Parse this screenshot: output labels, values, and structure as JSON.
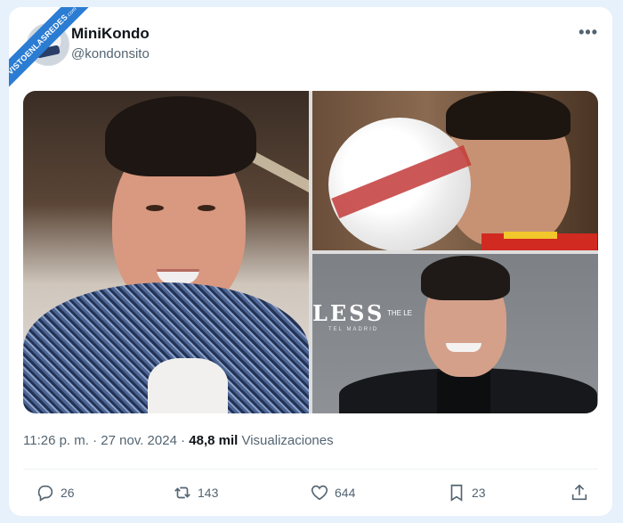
{
  "watermark": {
    "text": "VISTOENLASREDES",
    "suffix": ".com"
  },
  "tweet": {
    "author_name": "MiniKondo",
    "author_handle": "@kondonsito",
    "more_label": "•••",
    "time": "11:26 p. m.",
    "separator": "·",
    "date": "27 nov. 2024",
    "views_count": "48,8 mil",
    "views_label": "Visualizaciones"
  },
  "media": {
    "images": [
      {
        "description_icon": "photo"
      },
      {
        "description_icon": "photo"
      },
      {
        "description_icon": "photo"
      }
    ],
    "sign_text": "LESS",
    "sign_subtext": "TEL MADRID",
    "sign_logo": "THE LE"
  },
  "actions": {
    "replies": "26",
    "retweets": "143",
    "likes": "644",
    "bookmarks": "23"
  },
  "colors": {
    "background": "#e7f1fb",
    "text_primary": "#0f1419",
    "text_secondary": "#536471",
    "ribbon": "#2b7cd3"
  }
}
